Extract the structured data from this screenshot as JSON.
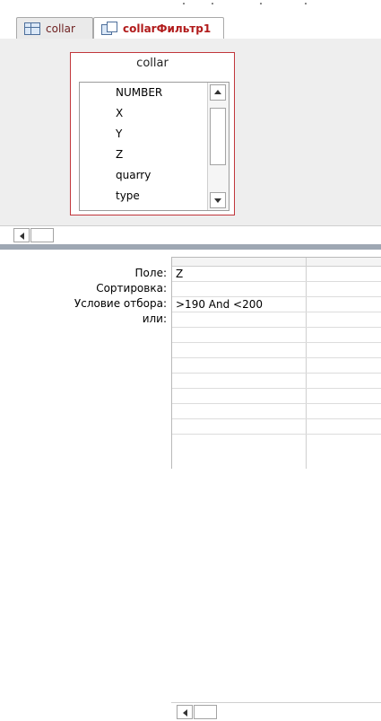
{
  "tabs": [
    {
      "label": "collar",
      "icon": "table-icon",
      "active": false
    },
    {
      "label": "collarФильтр1",
      "icon": "query-icon",
      "active": true
    }
  ],
  "table_card": {
    "title": "collar",
    "fields": [
      "NUMBER",
      "X",
      "Y",
      "Z",
      "quarry",
      "type"
    ]
  },
  "grid": {
    "row_labels": {
      "field": "Поле:",
      "sort": "Сортировка:",
      "criteria": "Условие отбора:",
      "or": "или:"
    },
    "columns": [
      {
        "field": "Z",
        "sort": "",
        "criteria": ">190 And <200",
        "or": ""
      },
      {
        "field": "",
        "sort": "",
        "criteria": "",
        "or": ""
      }
    ]
  },
  "colors": {
    "accent": "#b11b1b",
    "table_border": "#c1363b",
    "designer_bg": "#eeeeee",
    "splitter": "#9ea7b3"
  }
}
